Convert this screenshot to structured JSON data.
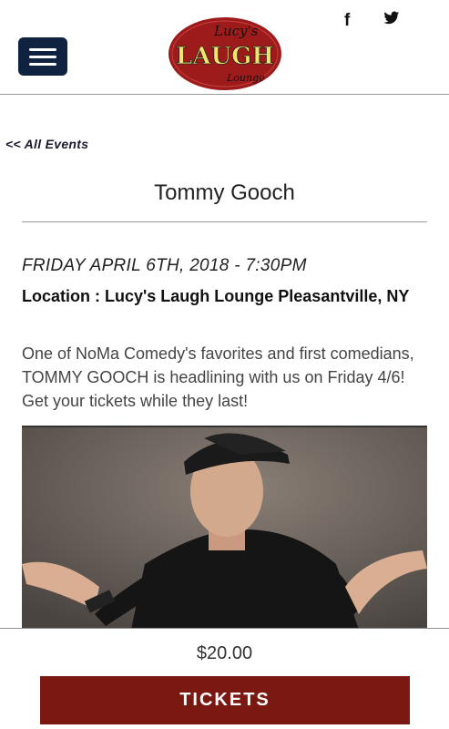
{
  "header": {
    "logo_text_top": "Lucy's",
    "logo_text_main": "LAUGH",
    "logo_text_bottom": "Lounge",
    "social": [
      {
        "icon": "facebook-icon",
        "glyph": "f"
      },
      {
        "icon": "twitter-icon",
        "glyph": "🐦"
      }
    ],
    "menu_icon": "hamburger-icon"
  },
  "nav": {
    "back_label": "<< All Events"
  },
  "event": {
    "title": "Tommy Gooch",
    "date": "FRIDAY APRIL 6TH, 2018 - 7:30PM",
    "location": "Location : Lucy's Laugh Lounge Pleasantville, NY",
    "description": "One of NoMa Comedy's favorites and first comedians, TOMMY GOOCH is headlining with us on Friday 4/6! Get your tickets while they last!"
  },
  "purchase": {
    "price": "$20.00",
    "button_label": "TICKETS"
  },
  "colors": {
    "menu_button": "#0f2240",
    "tickets_button": "#7a1812",
    "logo_oval": "#9e1b1b"
  }
}
